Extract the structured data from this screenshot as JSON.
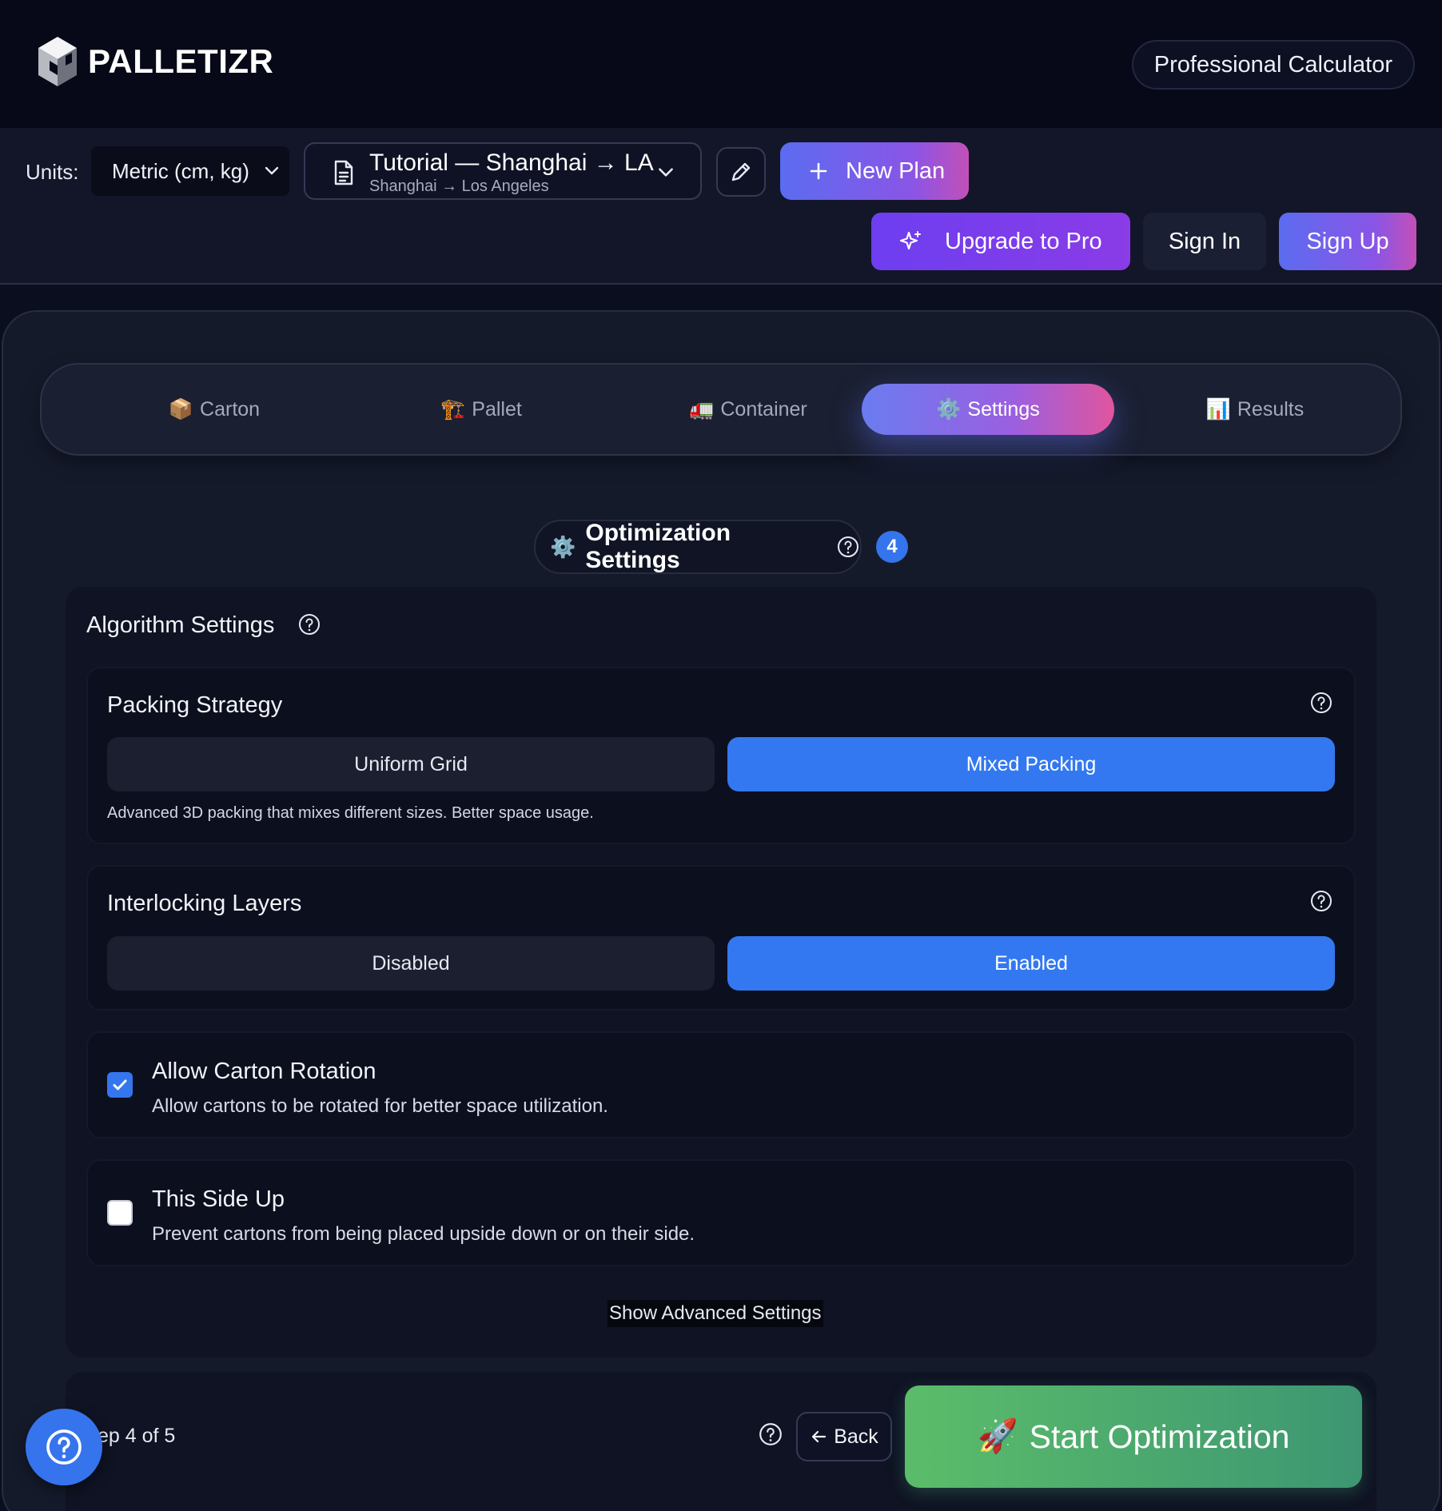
{
  "header": {
    "brand": "PALLETIZR",
    "badge": "Professional Calculator"
  },
  "toolbar": {
    "units_label": "Units:",
    "units_value": "Metric (cm, kg)",
    "plan_title": "Tutorial — Shanghai → LA",
    "plan_subtitle": "Shanghai → Los Angeles",
    "new_plan": "New Plan",
    "upgrade": "Upgrade to Pro",
    "sign_in": "Sign In",
    "sign_up": "Sign Up"
  },
  "tabs": [
    {
      "icon": "📦",
      "label": "Carton",
      "active": false
    },
    {
      "icon": "🏗️",
      "label": "Pallet",
      "active": false
    },
    {
      "icon": "🚛",
      "label": "Container",
      "active": false
    },
    {
      "icon": "⚙️",
      "label": "Settings",
      "active": true
    },
    {
      "icon": "📊",
      "label": "Results",
      "active": false
    }
  ],
  "section": {
    "icon": "⚙️",
    "title": "Optimization Settings",
    "step_number": "4"
  },
  "algorithm": {
    "title": "Algorithm Settings",
    "packing_strategy": {
      "title": "Packing Strategy",
      "options": [
        "Uniform Grid",
        "Mixed Packing"
      ],
      "selected": "Mixed Packing",
      "description": "Advanced 3D packing that mixes different sizes. Better space usage."
    },
    "interlocking": {
      "title": "Interlocking Layers",
      "options": [
        "Disabled",
        "Enabled"
      ],
      "selected": "Enabled"
    },
    "rotation": {
      "title": "Allow Carton Rotation",
      "description": "Allow cartons to be rotated for better space utilization.",
      "checked": true
    },
    "side_up": {
      "title": "This Side Up",
      "description": "Prevent cartons from being placed upside down or on their side.",
      "checked": false
    },
    "advanced_link": "Show Advanced Settings"
  },
  "footer": {
    "step_text": "ep 4 of 5",
    "back": "Back",
    "start_icon": "🚀",
    "start": "Start Optimization"
  },
  "colors": {
    "accent_blue": "#3378f0",
    "start_green": "#5bbd6a",
    "upgrade_purple": "#6d3ef0"
  }
}
